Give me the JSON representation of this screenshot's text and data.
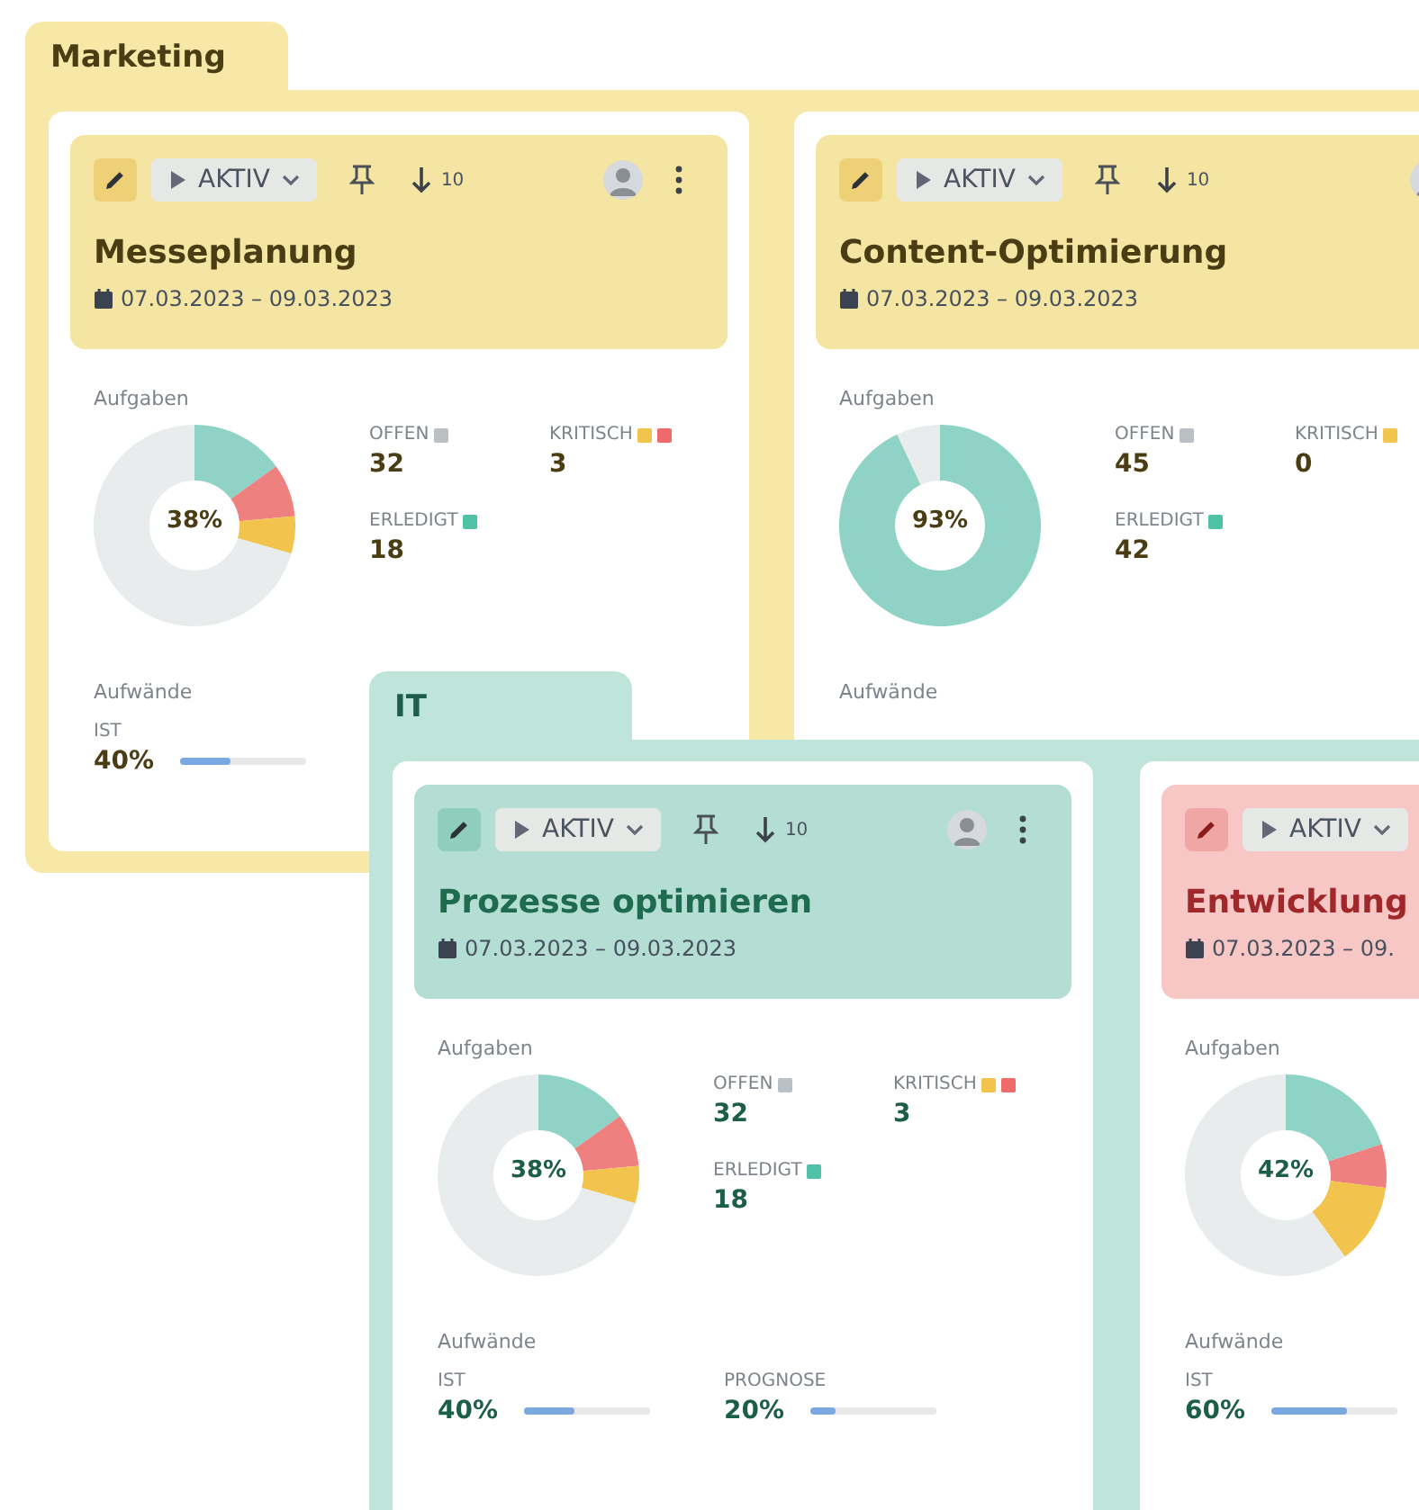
{
  "groups": [
    {
      "name": "Marketing",
      "kind": "yellow",
      "cards": [
        {
          "kind": "yellow",
          "toolbar": [
            {
              "kind": "edit"
            },
            {
              "kind": "status",
              "label": "AKTIV"
            },
            {
              "kind": "pin"
            },
            {
              "kind": "sort",
              "label": "10"
            },
            {
              "kind": "avatar"
            },
            {
              "kind": "menu"
            }
          ],
          "title": "Messeplanung",
          "date": "07.03.2023 – 09.03.2023",
          "tasks_label": "Aufgaben",
          "donut": {
            "center": "38%",
            "chart_data": {
              "type": "donut",
              "values": [
                15,
                8.5,
                6,
                70.5
              ],
              "colors": [
                "#8ed3c5",
                "#ef8080",
                "#f2c44d",
                "#e9ecec"
              ]
            }
          },
          "stats": [
            {
              "label": "OFFEN",
              "value": "32",
              "swatches": [
                {
                  "color": "#b9c0c6"
                }
              ]
            },
            {
              "label": "KRITISCH",
              "value": "3",
              "swatches": [
                {
                  "color": "#f2c44d"
                },
                {
                  "color": "#ef6a6a"
                }
              ]
            },
            {
              "label": "ERLEDIGT",
              "value": "18",
              "swatches": [
                {
                  "color": "#4fc1a6"
                }
              ]
            }
          ],
          "effort_label": "Aufwände",
          "efforts": [
            {
              "label": "IST",
              "value": "40%",
              "level": 0.4
            }
          ]
        },
        {
          "kind": "yellow",
          "toolbar": [
            {
              "kind": "edit"
            },
            {
              "kind": "status",
              "label": "AKTIV"
            },
            {
              "kind": "pin"
            },
            {
              "kind": "sort",
              "label": "10"
            },
            {
              "kind": "avatar"
            }
          ],
          "title": "Content-Optimierung",
          "date": "07.03.2023 – 09.03.2023",
          "tasks_label": "Aufgaben",
          "donut": {
            "center": "93%",
            "chart_data": {
              "type": "donut",
              "values": [
                93,
                7
              ],
              "colors": [
                "#8ed3c5",
                "#e9ecec"
              ]
            }
          },
          "stats": [
            {
              "label": "OFFEN",
              "value": "45",
              "swatches": [
                {
                  "color": "#b9c0c6"
                }
              ]
            },
            {
              "label": "KRITISCH",
              "value": "0",
              "swatches": [
                {
                  "color": "#f2c44d"
                }
              ]
            },
            {
              "label": "ERLEDIGT",
              "value": "42",
              "swatches": [
                {
                  "color": "#4fc1a6"
                }
              ]
            }
          ],
          "effort_label": "Aufwände"
        }
      ]
    },
    {
      "name": "IT",
      "kind": "teal",
      "cards": [
        {
          "kind": "teal",
          "toolbar": [
            {
              "kind": "edit"
            },
            {
              "kind": "status",
              "label": "AKTIV"
            },
            {
              "kind": "pin"
            },
            {
              "kind": "sort",
              "label": "10"
            },
            {
              "kind": "avatar"
            },
            {
              "kind": "menu"
            }
          ],
          "title": "Prozesse optimieren",
          "date": "07.03.2023 – 09.03.2023",
          "tasks_label": "Aufgaben",
          "donut": {
            "center": "38%",
            "chart_data": {
              "type": "donut",
              "values": [
                15,
                8.5,
                6,
                70.5
              ],
              "colors": [
                "#8ed3c5",
                "#ef8080",
                "#f2c44d",
                "#e9ecec"
              ]
            }
          },
          "stats": [
            {
              "label": "OFFEN",
              "value": "32",
              "swatches": [
                {
                  "color": "#b9c0c6"
                }
              ]
            },
            {
              "label": "KRITISCH",
              "value": "3",
              "swatches": [
                {
                  "color": "#f2c44d"
                },
                {
                  "color": "#ef6a6a"
                }
              ]
            },
            {
              "label": "ERLEDIGT",
              "value": "18",
              "swatches": [
                {
                  "color": "#4fc1a6"
                }
              ]
            }
          ],
          "effort_label": "Aufwände",
          "efforts": [
            {
              "label": "IST",
              "value": "40%",
              "level": 0.4
            },
            {
              "label": "PROGNOSE",
              "value": "20%",
              "level": 0.2
            }
          ]
        },
        {
          "kind": "red",
          "toolbar": [
            {
              "kind": "edit"
            },
            {
              "kind": "status",
              "label": "AKTIV"
            }
          ],
          "title": "Entwicklung",
          "date": "07.03.2023 – 09.",
          "tasks_label": "Aufgaben",
          "donut": {
            "center": "42%",
            "chart_data": {
              "type": "donut",
              "values": [
                20,
                7,
                13,
                60
              ],
              "colors": [
                "#8ed3c5",
                "#ef8080",
                "#f2c44d",
                "#e9ecec"
              ]
            }
          },
          "effort_label": "Aufwände",
          "efforts": [
            {
              "label": "IST",
              "value": "60%",
              "level": 0.6
            }
          ]
        }
      ]
    }
  ]
}
